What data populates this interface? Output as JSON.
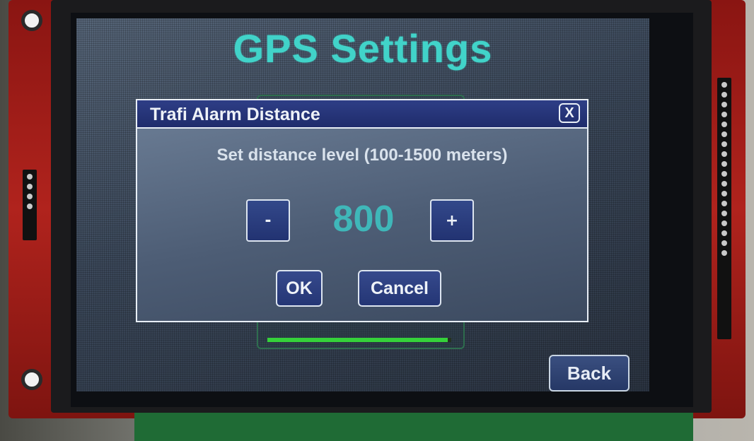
{
  "screen": {
    "title": "GPS Settings",
    "back_label": "Back",
    "progress_fraction": 0.98
  },
  "dialog": {
    "title": "Trafi Alarm Distance",
    "close_label": "X",
    "prompt": "Set distance level (100-1500 meters)",
    "minus_label": "-",
    "plus_label": "+",
    "value": "800",
    "ok_label": "OK",
    "cancel_label": "Cancel"
  },
  "colors": {
    "title_accent": "#41d3c9",
    "value_accent": "#3fb7b9",
    "titlebar": "#1f2c6c",
    "progress": "#35d23a"
  }
}
